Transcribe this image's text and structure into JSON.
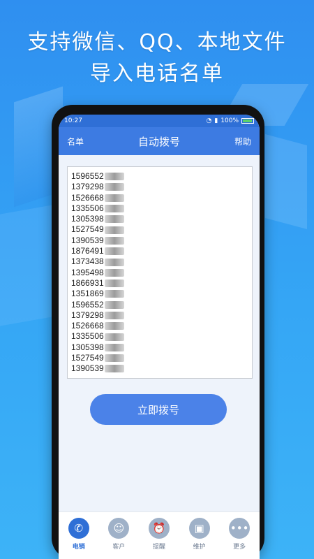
{
  "headline": {
    "line1": "支持微信、QQ、本地文件",
    "line2": "导入电话名单"
  },
  "status_bar": {
    "time": "10:27",
    "battery": "100%"
  },
  "title_bar": {
    "left": "名单",
    "title": "自动拨号",
    "right": "帮助"
  },
  "phone_list": [
    "1596552",
    "1379298",
    "1526668",
    "1335506",
    "1305398",
    "1527549",
    "1390539",
    "1876491",
    "1373438",
    "1395498",
    "1866931",
    "1351869",
    "1596552",
    "1379298",
    "1526668",
    "1335506",
    "1305398",
    "1527549",
    "1390539"
  ],
  "action_button": "立即拨号",
  "tabs": [
    {
      "label": "电销",
      "icon": "phone-icon"
    },
    {
      "label": "客户",
      "icon": "person-icon"
    },
    {
      "label": "提醒",
      "icon": "alarm-clock-icon"
    },
    {
      "label": "维护",
      "icon": "gift-icon"
    },
    {
      "label": "更多",
      "icon": "more-dots-icon"
    }
  ],
  "colors": {
    "accent": "#2f6fd6",
    "button": "#4b82e8"
  }
}
